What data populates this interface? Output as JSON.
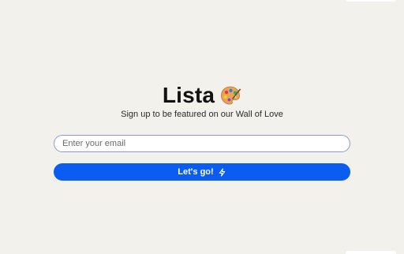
{
  "header": {
    "title": "Lista",
    "title_icon": "artist-palette-emoji",
    "subtitle": "Sign up to be featured on our Wall of Love"
  },
  "form": {
    "email_placeholder": "Enter your email",
    "email_value": "",
    "submit_label": "Let's go!",
    "submit_icon": "lightning-bolt-icon"
  },
  "colors": {
    "background": "#f3f1ec",
    "accent": "#0b5cf0",
    "input_border": "#8f98d6"
  }
}
